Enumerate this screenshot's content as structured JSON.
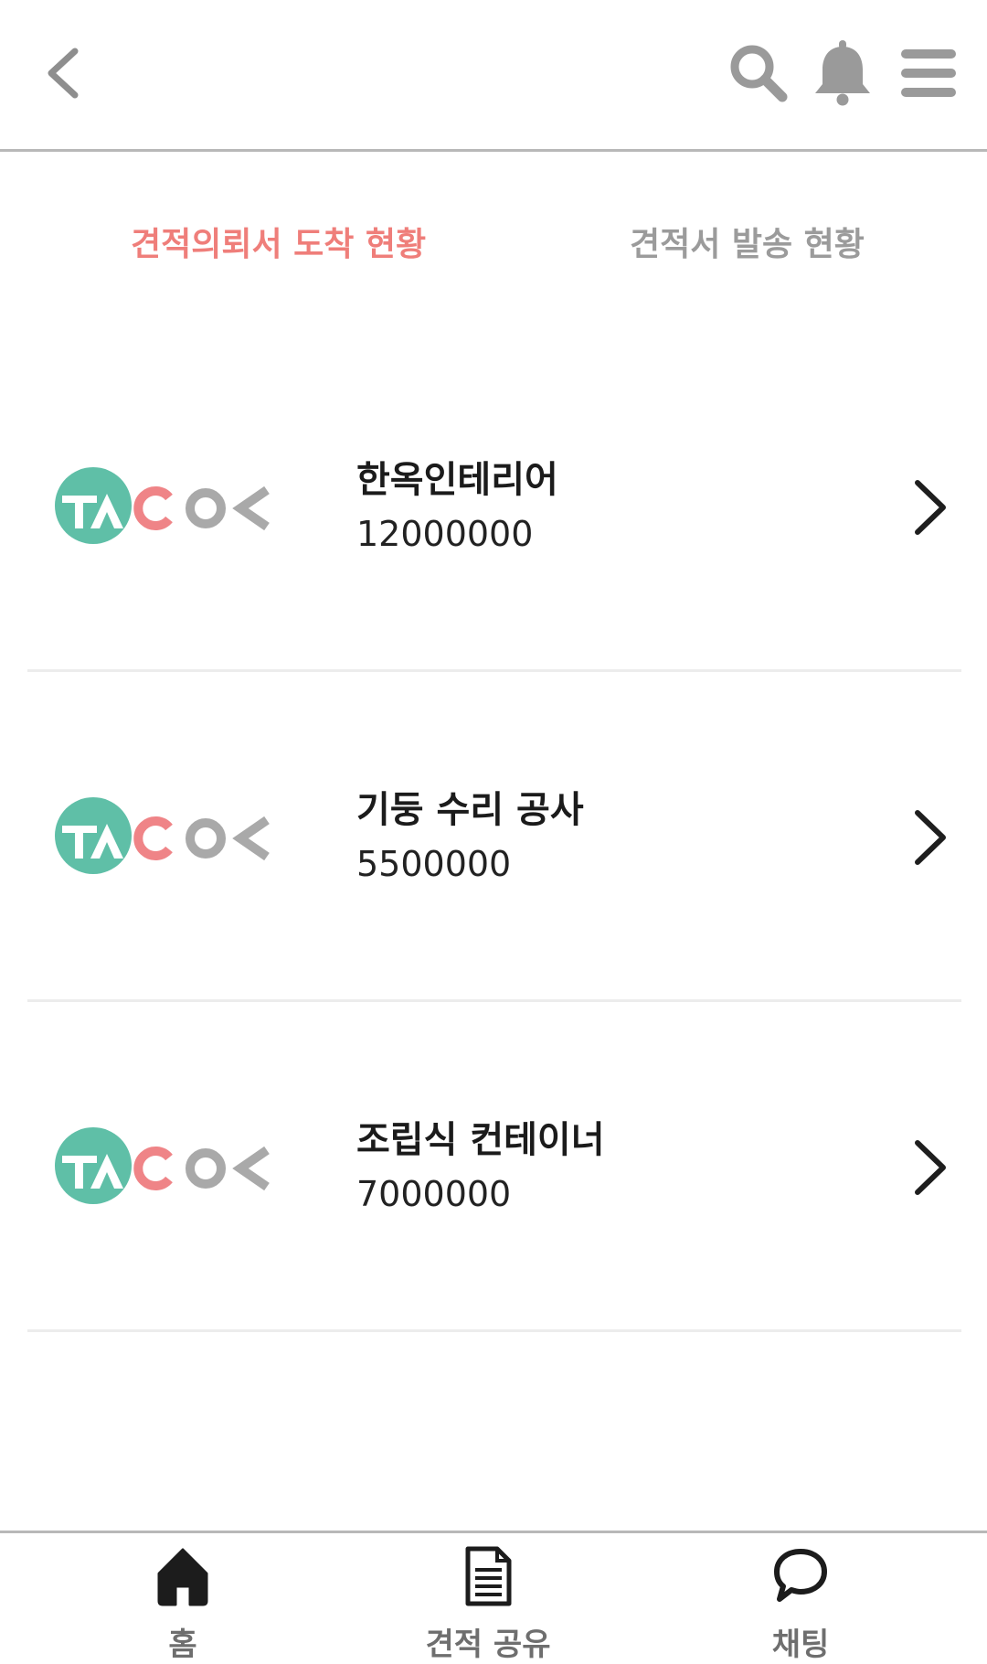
{
  "header": {
    "back_icon": "chevron-left-icon",
    "search_icon": "search-icon",
    "bell_icon": "bell-icon",
    "menu_icon": "hamburger-menu-icon"
  },
  "tabs": [
    {
      "label": "견적의뢰서 도착 현황",
      "active": true
    },
    {
      "label": "견적서 발송 현황",
      "active": false
    }
  ],
  "colors": {
    "active_tab": "#ef7e7a",
    "inactive_tab": "#9b9b9b",
    "logo_teal": "#5fbfa7",
    "logo_pink": "#ef8487",
    "logo_gray": "#a9a9a9"
  },
  "quotes": [
    {
      "logo": "TACO",
      "title": "한옥인테리어",
      "price": "12000000"
    },
    {
      "logo": "TACO",
      "title": "기둥 수리 공사",
      "price": "5500000"
    },
    {
      "logo": "TACO",
      "title": "조립식 컨테이너",
      "price": "7000000"
    }
  ],
  "bottom_nav": [
    {
      "label": "홈",
      "icon": "home-icon"
    },
    {
      "label": "견적 공유",
      "icon": "document-icon"
    },
    {
      "label": "채팅",
      "icon": "chat-bubble-icon"
    }
  ]
}
